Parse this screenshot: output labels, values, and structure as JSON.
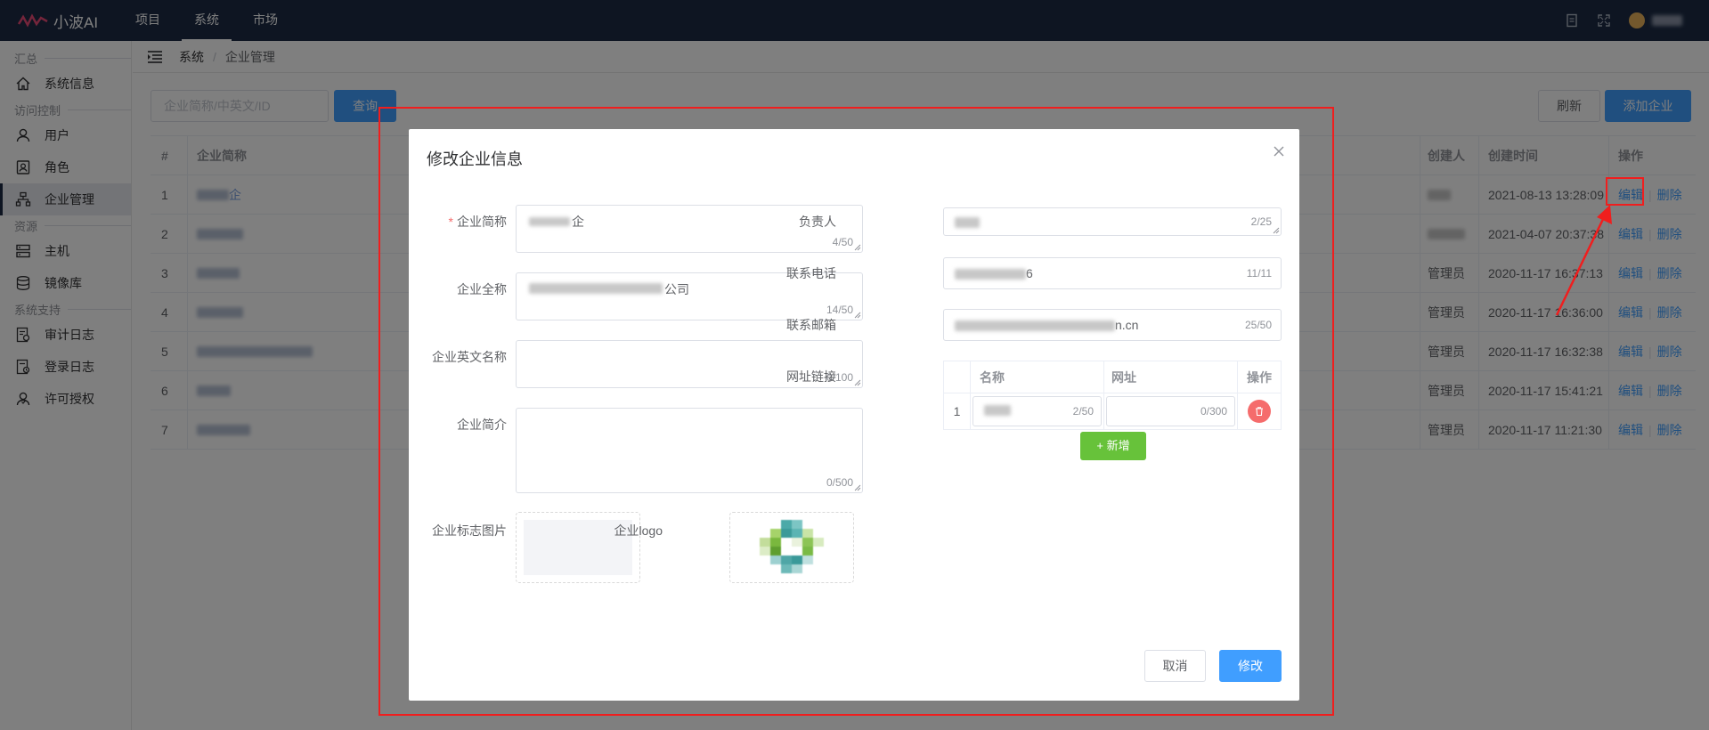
{
  "topbar": {
    "brand": "小波AI",
    "nav": [
      {
        "label": "项目",
        "active": false
      },
      {
        "label": "系统",
        "active": true
      },
      {
        "label": "市场",
        "active": false
      }
    ]
  },
  "sidebar": {
    "groups": [
      {
        "label": "汇总",
        "items": [
          {
            "label": "系统信息",
            "icon": "home-icon"
          }
        ]
      },
      {
        "label": "访问控制",
        "items": [
          {
            "label": "用户",
            "icon": "user-icon"
          },
          {
            "label": "角色",
            "icon": "role-icon"
          },
          {
            "label": "企业管理",
            "icon": "org-icon",
            "active": true
          }
        ]
      },
      {
        "label": "资源",
        "items": [
          {
            "label": "主机",
            "icon": "server-icon"
          },
          {
            "label": "镜像库",
            "icon": "database-icon"
          }
        ]
      },
      {
        "label": "系统支持",
        "items": [
          {
            "label": "审计日志",
            "icon": "audit-log-icon"
          },
          {
            "label": "登录日志",
            "icon": "login-log-icon"
          },
          {
            "label": "许可授权",
            "icon": "license-icon"
          }
        ]
      }
    ]
  },
  "breadcrumb": {
    "items": [
      "系统",
      "企业管理"
    ]
  },
  "toolbar": {
    "search_placeholder": "企业简称/中英文/ID",
    "query_label": "查询",
    "refresh_label": "刷新",
    "add_label": "添加企业"
  },
  "table": {
    "columns": [
      "#",
      "企业简称",
      "创建人",
      "创建时间",
      "操作"
    ],
    "rows": [
      {
        "idx": "1",
        "name": "企",
        "creator": "",
        "time": "2021-08-13 13:28:09"
      },
      {
        "idx": "2",
        "name": "",
        "creator": "",
        "time": "2021-04-07 20:37:38"
      },
      {
        "idx": "3",
        "name": "",
        "creator": "管理员",
        "time": "2020-11-17 16:37:13"
      },
      {
        "idx": "4",
        "name": "",
        "creator": "管理员",
        "time": "2020-11-17 16:36:00"
      },
      {
        "idx": "5",
        "name": "",
        "creator": "管理员",
        "time": "2020-11-17 16:32:38"
      },
      {
        "idx": "6",
        "name": "",
        "creator": "管理员",
        "time": "2020-11-17 15:41:21"
      },
      {
        "idx": "7",
        "name": "",
        "creator": "管理员",
        "time": "2020-11-17 11:21:30"
      }
    ],
    "edit_label": "编辑",
    "delete_label": "删除"
  },
  "dialog": {
    "title": "修改企业信息",
    "fields": {
      "short_name": {
        "label": "企业简称",
        "required": "*",
        "value": "企",
        "counter": "4/50"
      },
      "full_name": {
        "label": "企业全称",
        "value": "公司",
        "counter": "14/50"
      },
      "english_name": {
        "label": "企业英文名称",
        "value": "",
        "counter": "0/100"
      },
      "intro": {
        "label": "企业简介",
        "value": "",
        "counter": "0/500"
      },
      "logo_image": {
        "label": "企业标志图片"
      },
      "logo": {
        "label": "企业logo"
      },
      "owner": {
        "label": "负责人",
        "value": "",
        "counter": "2/25"
      },
      "phone": {
        "label": "联系电话",
        "value": "6",
        "counter": "11/11"
      },
      "email": {
        "label": "联系邮箱",
        "value": "n.cn",
        "counter": "25/50"
      },
      "links": {
        "label": "网址链接",
        "columns": [
          "名称",
          "网址",
          "操作"
        ],
        "rows": [
          {
            "idx": "1",
            "name_counter": "2/50",
            "url_counter": "0/300"
          }
        ],
        "add_label": "+ 新增"
      }
    },
    "cancel_label": "取消",
    "submit_label": "修改"
  },
  "colors": {
    "topbar_bg": "#1c2b45",
    "primary": "#409eff",
    "success": "#67c23a",
    "danger": "#f56c6c",
    "annotation_red": "#f01e1e"
  }
}
